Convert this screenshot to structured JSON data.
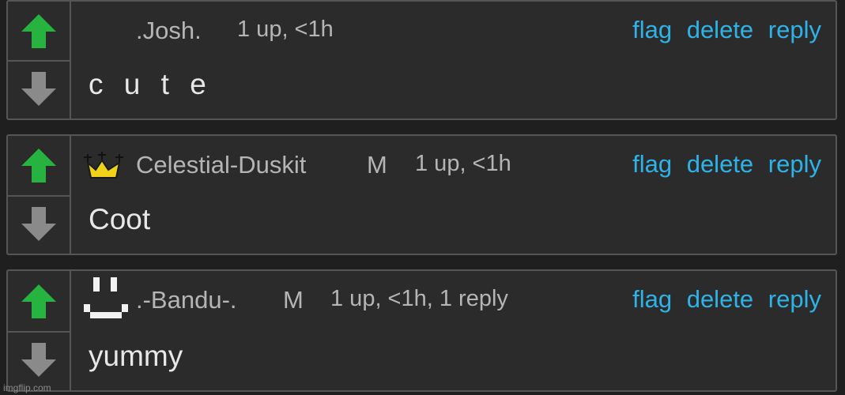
{
  "comments": [
    {
      "username": ".Josh.",
      "mod_label": "",
      "meta": "1 up, <1h",
      "text": "c u t e",
      "badge": "none",
      "actions": {
        "flag": "flag",
        "delete": "delete",
        "reply": "reply"
      }
    },
    {
      "username": "Celestial-Duskit",
      "mod_label": "M",
      "meta": "1 up, <1h",
      "text": "Coot",
      "badge": "crown-icon",
      "actions": {
        "flag": "flag",
        "delete": "delete",
        "reply": "reply"
      }
    },
    {
      "username": ".-Bandu-.",
      "mod_label": "M",
      "meta": "1 up, <1h, 1 reply",
      "text": "yummy",
      "badge": "pixel-smiley-icon",
      "actions": {
        "flag": "flag",
        "delete": "delete",
        "reply": "reply"
      }
    }
  ],
  "watermark": "imgflip.com",
  "colors": {
    "upvote": "#27b33f",
    "downvote": "#8a8a8a",
    "link": "#2eb3e8",
    "background": "#2b2b2c",
    "border": "#555555",
    "crown": "#f0d21a"
  }
}
